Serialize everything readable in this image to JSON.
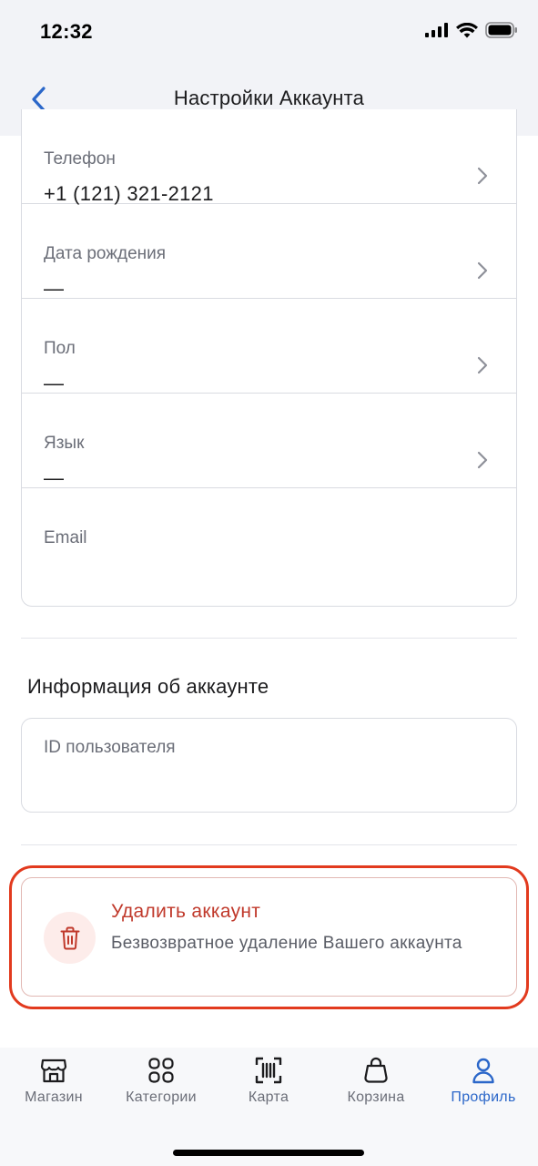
{
  "status_bar": {
    "time": "12:32"
  },
  "header": {
    "title": "Настройки Аккаунта"
  },
  "account_fields": [
    {
      "label": "Телефон",
      "value": "+1 (121) 321-2121",
      "has_chevron": true
    },
    {
      "label": "Дата рождения",
      "value": "—",
      "has_chevron": true
    },
    {
      "label": "Пол",
      "value": "—",
      "has_chevron": true
    },
    {
      "label": "Язык",
      "value": "—",
      "has_chevron": true
    },
    {
      "label": "Email",
      "value": "",
      "has_chevron": false
    }
  ],
  "account_info": {
    "title": "Информация об аккаунте",
    "user_id_label": "ID пользователя",
    "user_id_value": ""
  },
  "delete_account": {
    "title": "Удалить аккаунт",
    "subtitle": "Безвозвратное удаление Вашего аккаунта"
  },
  "tabbar": {
    "items": [
      {
        "label": "Магазин",
        "icon": "store-icon",
        "active": false
      },
      {
        "label": "Категории",
        "icon": "grid-icon",
        "active": false
      },
      {
        "label": "Карта",
        "icon": "barcode-scan-icon",
        "active": false
      },
      {
        "label": "Корзина",
        "icon": "bag-icon",
        "active": false
      },
      {
        "label": "Профиль",
        "icon": "person-icon",
        "active": true
      }
    ]
  },
  "colors": {
    "accent": "#2b67c9",
    "danger": "#c0392b",
    "highlight_outline": "#e23a1e",
    "header_bg": "#f2f3f7"
  }
}
